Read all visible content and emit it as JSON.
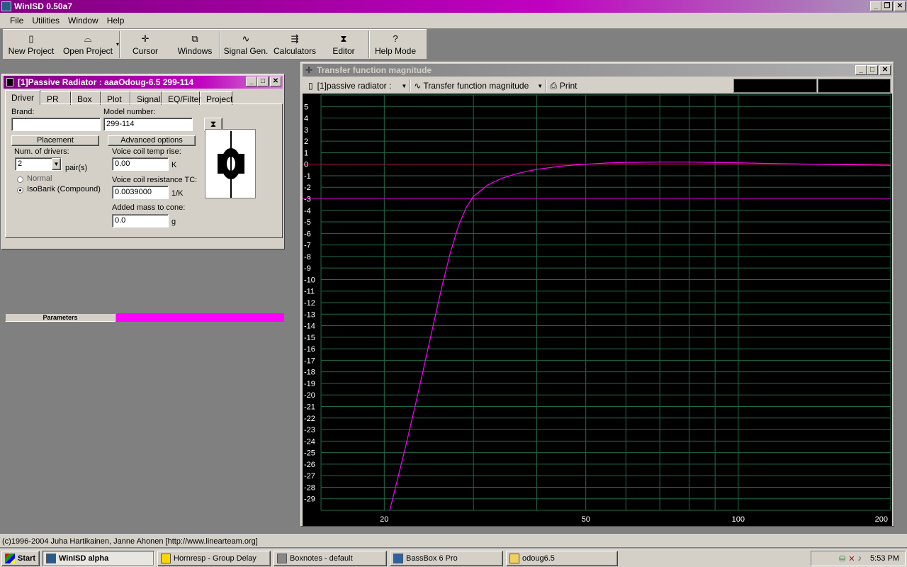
{
  "app": {
    "title": "WinISD 0.50a7"
  },
  "menu": [
    "File",
    "Utilities",
    "Window",
    "Help"
  ],
  "toolbar": [
    {
      "label": "New Project",
      "icon": "new-project-icon"
    },
    {
      "label": "Open Project",
      "icon": "open-folder-icon"
    },
    {
      "label": "Cursor",
      "icon": "cursor-icon"
    },
    {
      "label": "Windows",
      "icon": "windows-icon"
    },
    {
      "label": "Signal Gen.",
      "icon": "sine-wave-icon"
    },
    {
      "label": "Calculators",
      "icon": "calculator-icon"
    },
    {
      "label": "Editor",
      "icon": "editor-icon"
    },
    {
      "label": "Help Mode",
      "icon": "question-icon"
    }
  ],
  "pr_window": {
    "title": "[1]Passive Radiator : aaaOdoug-6.5 299-114",
    "tabs": [
      "Driver",
      "PR",
      "Box",
      "Plot",
      "Signal",
      "EQ/Filter",
      "Project"
    ],
    "brand_label": "Brand:",
    "brand_value": "",
    "model_label": "Model number:",
    "model_value": "299-114",
    "placement_button": "Placement",
    "advanced_button": "Advanced options",
    "num_drivers_label": "Num. of drivers:",
    "num_drivers_value": "2",
    "pairs_label": "pair(s)",
    "radio_normal": "Normal",
    "radio_isobarik": "IsoBarik (Compound)",
    "vc_temp_label": "Voice coil temp rise:",
    "vc_temp_value": "0.00",
    "vc_temp_unit": "K",
    "vc_res_label": "Voice coil resistance TC:",
    "vc_res_value": "0.0039000",
    "vc_res_unit": "1/K",
    "added_mass_label": "Added mass to cone:",
    "added_mass_value": "0.0",
    "added_mass_unit": "g",
    "parameters_label": "Parameters",
    "accent": "#ff00ff"
  },
  "graph_window": {
    "title": "Transfer function magnitude",
    "project_select": "[1]passive radiator :",
    "graph_select": "Transfer function magnitude",
    "print_label": "Print"
  },
  "chart_data": {
    "type": "line",
    "xscale": "log",
    "xlim": [
      15,
      200
    ],
    "ylim": [
      -30,
      6
    ],
    "x_ticks": [
      20,
      50,
      100,
      200
    ],
    "y_ticks": [
      5,
      4,
      3,
      2,
      1,
      0,
      -1,
      -2,
      -3,
      -4,
      -5,
      -6,
      -7,
      -8,
      -9,
      -10,
      -11,
      -12,
      -13,
      -14,
      -15,
      -16,
      -17,
      -18,
      -19,
      -20,
      -21,
      -22,
      -23,
      -24,
      -25,
      -26,
      -27,
      -28,
      -29
    ],
    "reference_lines": [
      0,
      -3
    ],
    "series": [
      {
        "color": "#ff00ff",
        "x": [
          20.5,
          21,
          22,
          23,
          24,
          25,
          26,
          27,
          28,
          29,
          30,
          32,
          34,
          36,
          38,
          40,
          45,
          50,
          55,
          60,
          70,
          80,
          100,
          120,
          150,
          200
        ],
        "y": [
          -30,
          -28.2,
          -24.6,
          -21.0,
          -17.4,
          -13.9,
          -10.6,
          -7.7,
          -5.4,
          -3.8,
          -2.8,
          -1.8,
          -1.25,
          -0.9,
          -0.65,
          -0.45,
          -0.15,
          0,
          0.1,
          0.15,
          0.18,
          0.18,
          0.12,
          0.05,
          -0.02,
          -0.1
        ]
      }
    ],
    "grid": true,
    "background": "#000000",
    "grid_color": "#1f6b4a"
  },
  "statusline": "(c)1996-2004 Juha Hartikainen, Janne Ahonen [http://www.linearteam.org]",
  "taskbar": {
    "start": "Start",
    "items": [
      {
        "label": "WinISD alpha",
        "active": true,
        "icon": "winisd-icon"
      },
      {
        "label": "Hornresp - Group Delay",
        "active": false,
        "icon": "hornresp-icon"
      },
      {
        "label": "Boxnotes - default",
        "active": false,
        "icon": "boxnotes-icon"
      },
      {
        "label": "BassBox 6 Pro",
        "active": false,
        "icon": "bassbox-icon"
      },
      {
        "label": "odoug6.5",
        "active": false,
        "icon": "folder-icon"
      }
    ],
    "clock": "5:53 PM"
  }
}
